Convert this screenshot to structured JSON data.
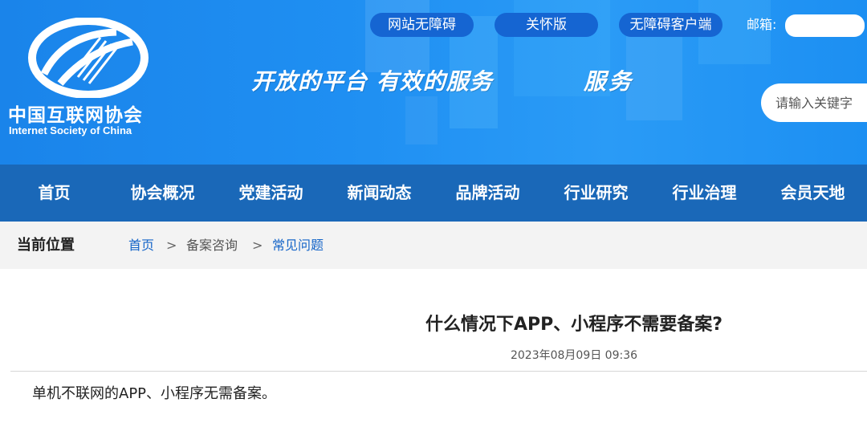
{
  "header": {
    "logo_cn": "中国互联网协会",
    "logo_en": "Internet Society of China",
    "top_links": [
      "网站无障碍",
      "关怀版",
      "无障碍客户端"
    ],
    "mail_label": "邮箱:",
    "slogan_1": "开放的平台  有效的服务",
    "slogan_2": "服务",
    "search_placeholder": "请输入关键字"
  },
  "nav": {
    "items": [
      "首页",
      "协会概况",
      "党建活动",
      "新闻动态",
      "品牌活动",
      "行业研究",
      "行业治理",
      "会员天地"
    ]
  },
  "breadcrumb": {
    "label": "当前位置",
    "items": [
      "首页",
      "备案咨询",
      "常见问题"
    ],
    "separator": ">"
  },
  "article": {
    "title": "什么情况下APP、小程序不需要备案?",
    "date": "2023年08月09日 09:36",
    "body": "单机不联网的APP、小程序无需备案。"
  },
  "colors": {
    "header_blue": "#1f8ff2",
    "nav_blue": "#1a68b8",
    "pill_blue": "#1565d2",
    "link_blue": "#1565c8",
    "breadcrumb_bg": "#f3f3f3"
  }
}
